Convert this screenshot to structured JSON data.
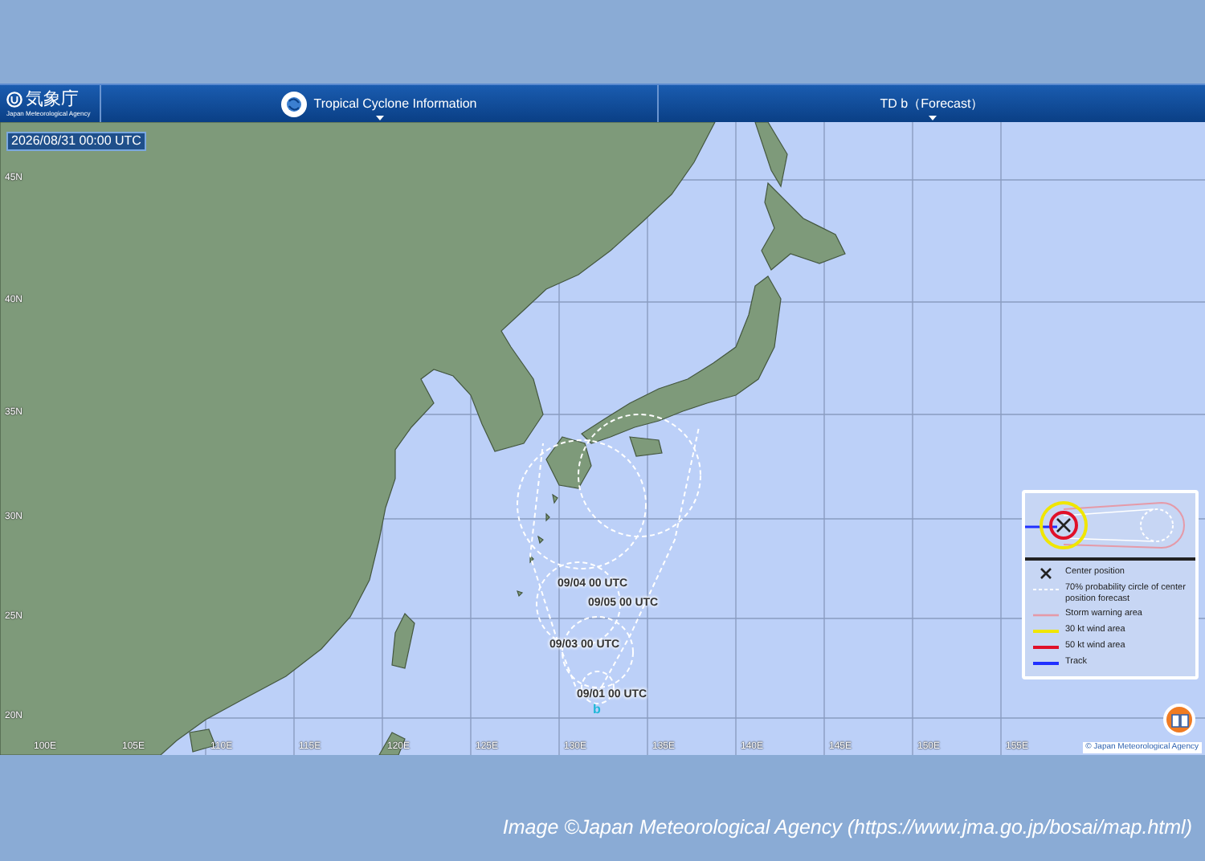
{
  "header": {
    "logo_title": "気象庁",
    "logo_subtitle": "Japan Meteorological Agency",
    "menu": "Tropical Cyclone Information",
    "selector": "TD b（Forecast）"
  },
  "map": {
    "timestamp": "2026/08/31 00:00 UTC",
    "lat_labels": [
      "45N",
      "40N",
      "35N",
      "30N",
      "25N",
      "20N"
    ],
    "lon_labels": [
      "100E",
      "105E",
      "110E",
      "115E",
      "120E",
      "125E",
      "130E",
      "135E",
      "140E",
      "145E",
      "150E",
      "155E"
    ],
    "forecast_labels": [
      "09/04 00 UTC",
      "09/05 00 UTC",
      "09/03 00 UTC",
      "09/01 00 UTC"
    ],
    "storm_label": "b",
    "copyright": "© Japan Meteorological Agency"
  },
  "legend": {
    "items": [
      {
        "kind": "center",
        "label": "Center position"
      },
      {
        "kind": "circle",
        "label": "70% probability circle of center position forecast"
      },
      {
        "kind": "storm",
        "label": "Storm warning area"
      },
      {
        "kind": "wind30",
        "label": "30 kt wind area"
      },
      {
        "kind": "wind50",
        "label": "50 kt wind area"
      },
      {
        "kind": "track",
        "label": "Track"
      }
    ]
  },
  "caption": "Image ©Japan Meteorological Agency (https://www.jma.go.jp/bosai/map.html)"
}
